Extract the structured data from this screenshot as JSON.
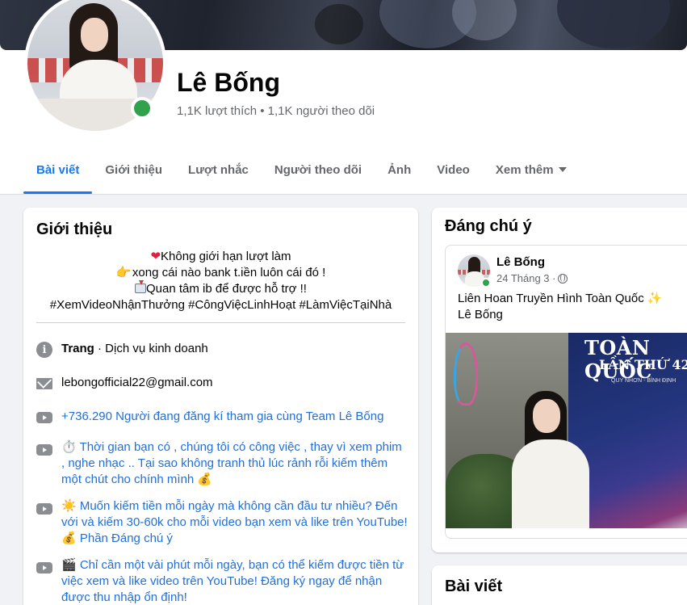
{
  "profile": {
    "name": "Lê Bống",
    "stats": "1,1K lượt thích • 1,1K người theo dõi"
  },
  "tabs": [
    "Bài viết",
    "Giới thiệu",
    "Lượt nhắc",
    "Người theo dõi",
    "Ảnh",
    "Video",
    "Xem thêm"
  ],
  "active_tab": "Bài viết",
  "intro": {
    "title": "Giới thiệu",
    "bio": [
      "Không giới hạn lượt làm",
      "xong cái nào bank t.iền luôn cái đó !",
      "Quan tâm ib để được hỗ trợ !!",
      "#XemVideoNhậnThưởng #CôngViệcLinhHoạt #LàmViệcTạiNhà"
    ],
    "bio_emojis": [
      "heart-icon",
      "pointing-hand-icon",
      "inbox-tray-icon"
    ],
    "page_label": "Trang",
    "page_category": " · Dịch vụ kinh doanh",
    "email": "lebongofficial22@gmail.com",
    "links": [
      "+736.290 Người đang đăng kí tham gia cùng Team Lê Bống",
      "⏱️ Thời gian bạn có , chúng tôi có công việc , thay vì xem phim , nghe nhạc .. Tại sao không tranh thủ lúc rảnh rỗi kiếm thêm một chút cho chính mình 💰",
      "☀️ Muốn kiếm tiền mỗi ngày mà không cần đầu tư nhiều? Đến với và kiếm 30-60k cho mỗi video bạn xem và like trên YouTube! 💰 Phần Đáng chú ý",
      "🎬 Chỉ cần một vài phút mỗi ngày, bạn có thể kiếm được tiền từ việc xem và like video trên YouTube! Đăng ký ngay để nhận được thu nhập ổn định!"
    ]
  },
  "featured": {
    "title": "Đáng chú ý",
    "post": {
      "author": "Lê Bống",
      "date": "24 Tháng 3 · ",
      "text": "Liên Hoan Truyền Hình Toàn Quốc ✨",
      "text2": "Lê Bống",
      "image_banner": {
        "line1": "TOÀN QUỐC",
        "line2": "LẦN THỨ 42",
        "line3": "QUY NHƠN - BÌNH ĐỊNH"
      }
    }
  },
  "posts_section": {
    "title": "Bài viết"
  },
  "colors": {
    "accent": "#1877f2",
    "link": "#216fdb",
    "online": "#31a24c",
    "background": "#f0f2f5"
  }
}
